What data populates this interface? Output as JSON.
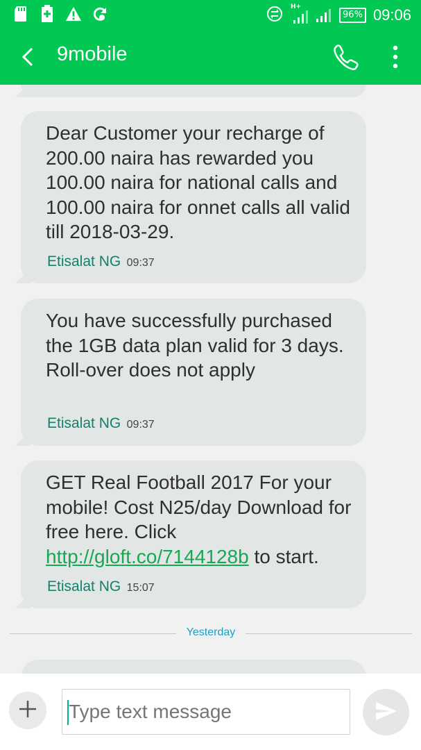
{
  "status_bar": {
    "battery": "96%",
    "time": "09:06",
    "network_type": "H+"
  },
  "app_bar": {
    "title": "9mobile"
  },
  "messages": [
    {
      "text": "Dear Customer your recharge of 200.00 naira has rewarded you 100.00 naira for national calls and 100.00 naira for onnet calls all valid till 2018-03-29.",
      "sender": "Etisalat NG",
      "time": "09:37"
    },
    {
      "text": "You have successfully purchased the 1GB data plan valid for 3 days. Roll-over does not apply",
      "sender": "Etisalat NG",
      "time": "09:37"
    },
    {
      "text_before_link": "GET Real Football 2017 For your mobile! Cost N25/day Download for free here. Click ",
      "link": "http://gloft.co/7144128b",
      "text_after_link": " to start.",
      "sender": "Etisalat NG",
      "time": "15:07"
    }
  ],
  "date_divider": "Yesterday",
  "compose": {
    "placeholder": "Type text message"
  },
  "colors": {
    "accent": "#00c853",
    "bubble": "#e2e6e5",
    "sender": "#14806c",
    "link": "#16a853",
    "divider_label": "#1aa0c8"
  },
  "icons": [
    "sd-card-icon",
    "battery-saver-icon",
    "warning-icon",
    "sync-icon",
    "data-transfer-icon",
    "signal-icon",
    "signal-icon",
    "back-arrow-icon",
    "phone-icon",
    "more-vert-icon",
    "plus-icon",
    "send-icon"
  ]
}
